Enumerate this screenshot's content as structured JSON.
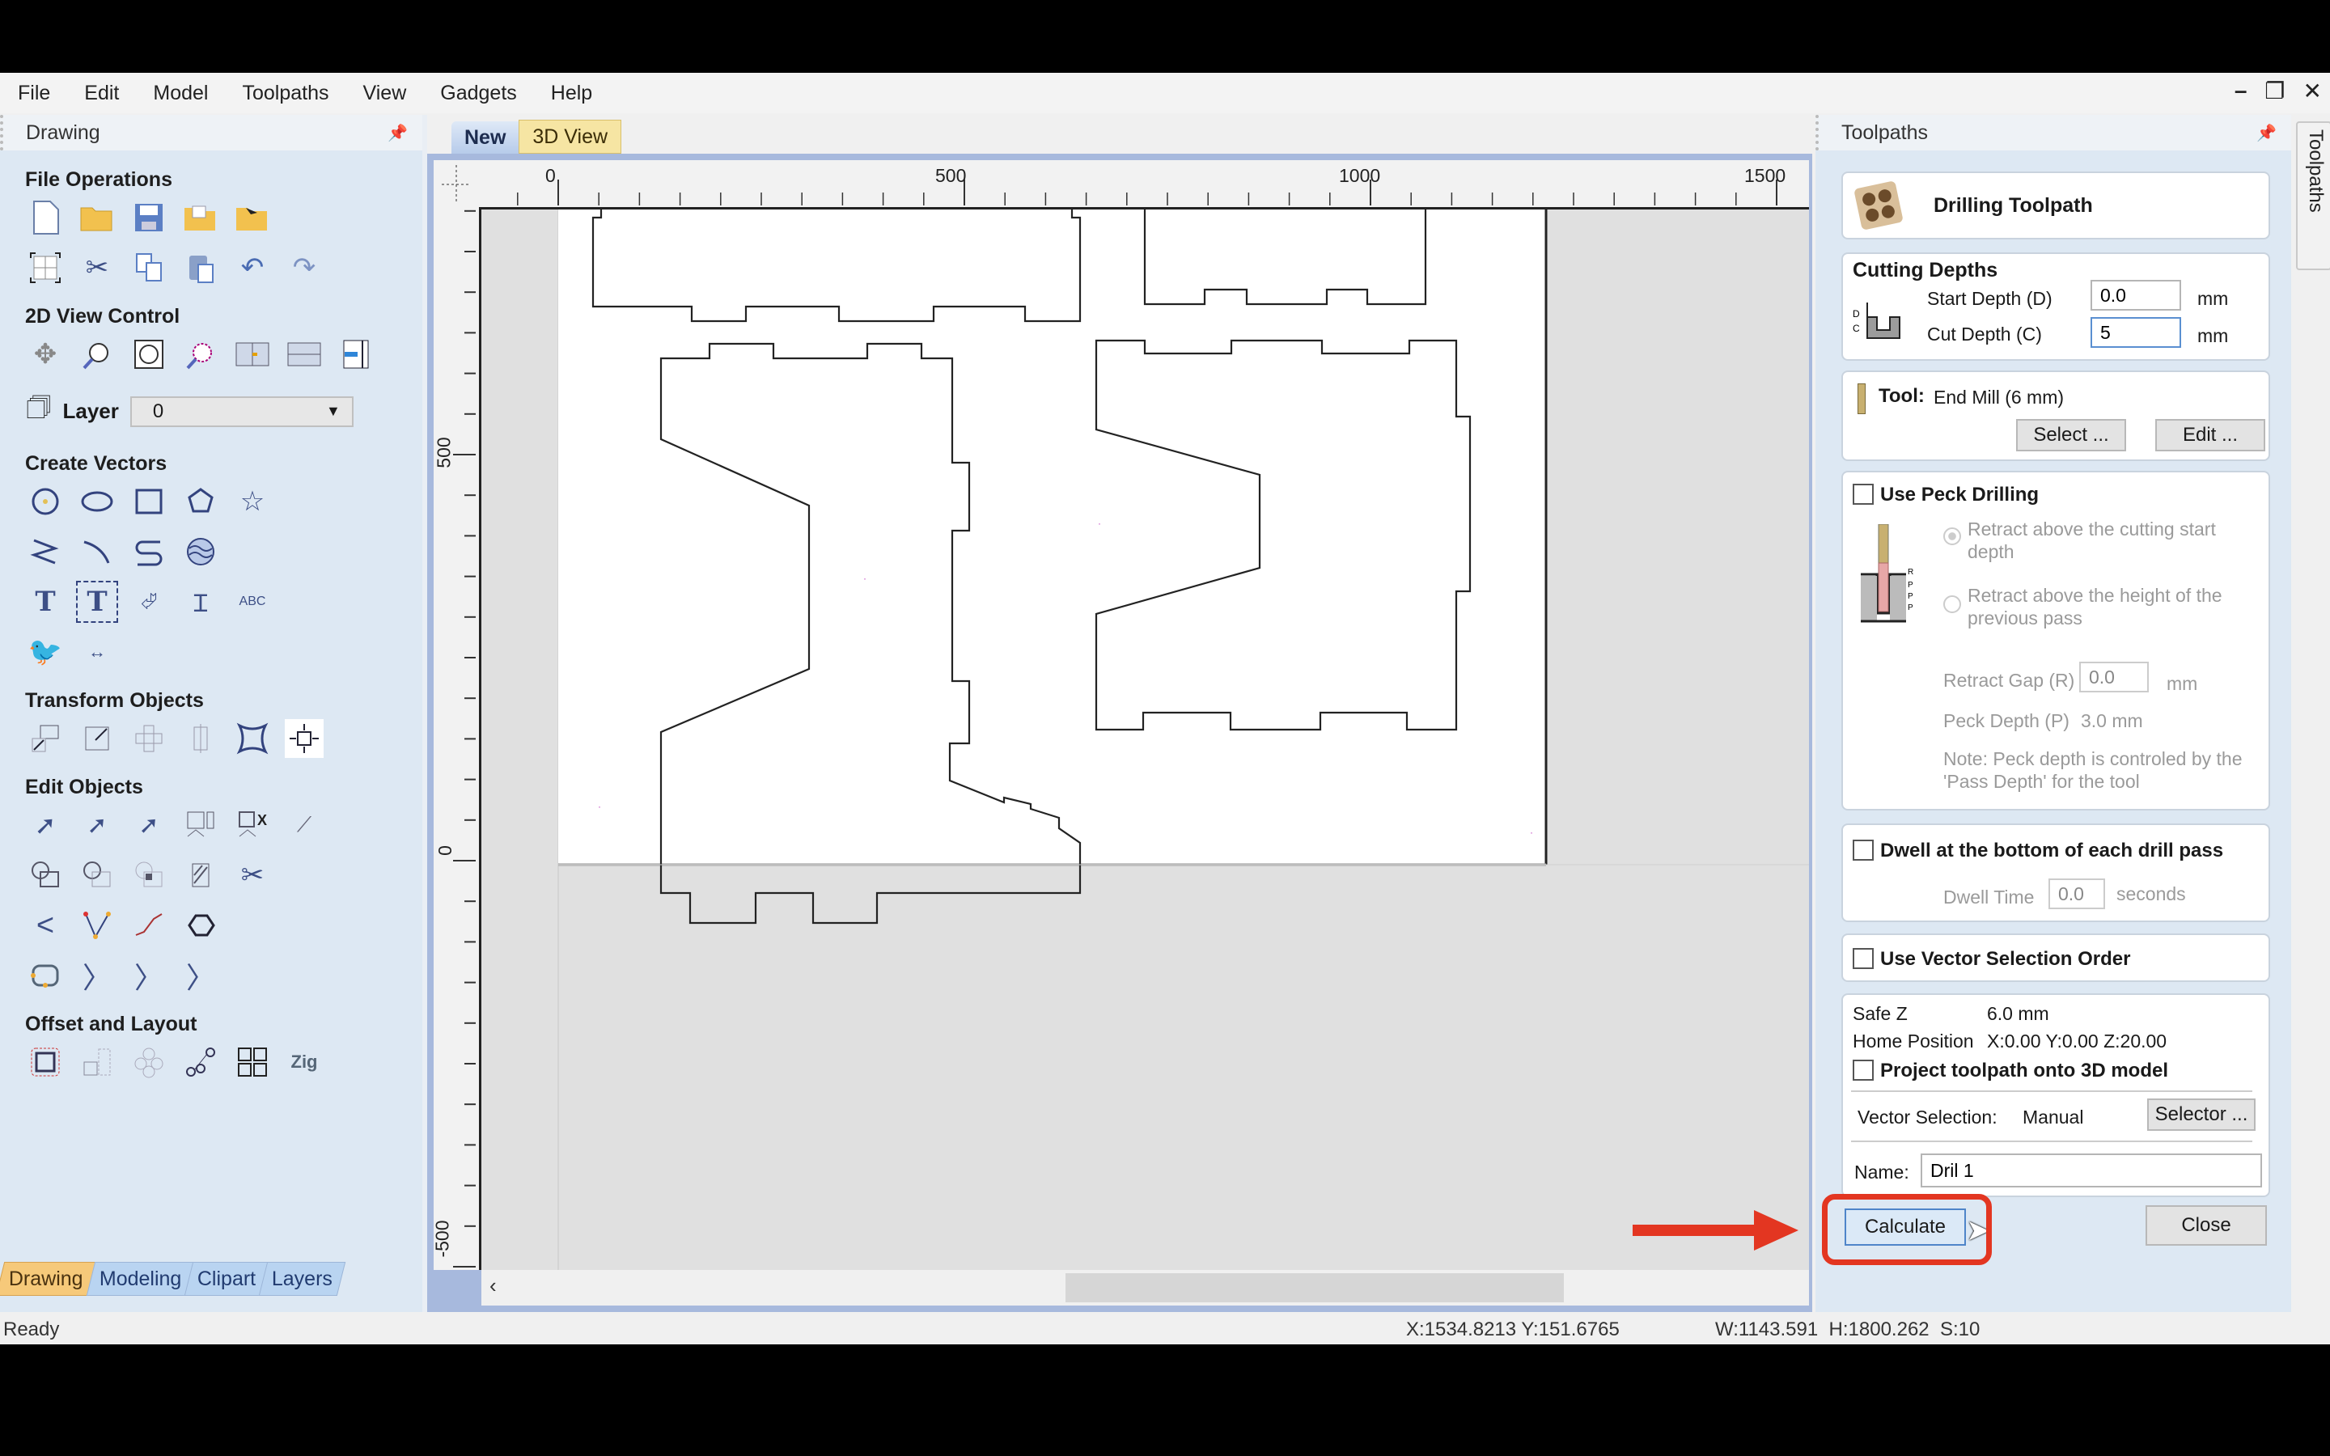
{
  "menu": [
    "File",
    "Edit",
    "Model",
    "Toolpaths",
    "View",
    "Gadgets",
    "Help"
  ],
  "window_controls": {
    "minimize": "–",
    "restore": "❐",
    "close": "✕"
  },
  "left_panel": {
    "title": "Drawing",
    "sections": {
      "file_ops": "File Operations",
      "view_control": "2D View Control",
      "create_vectors": "Create Vectors",
      "transform": "Transform Objects",
      "edit": "Edit Objects",
      "offset": "Offset and Layout"
    },
    "layer_label": "Layer",
    "layer_value": "0",
    "bottom_tabs": [
      "Drawing",
      "Modeling",
      "Clipart",
      "Layers"
    ],
    "active_tab": "Drawing"
  },
  "document": {
    "tabs": [
      "New",
      "3D View"
    ],
    "active_tab": "New",
    "h_ruler_labels": [
      "0",
      "500",
      "1000",
      "1500"
    ],
    "v_ruler_labels": [
      "500",
      "0",
      "-500"
    ]
  },
  "toolpaths": {
    "panel_title": "Toolpaths",
    "side_tab": "Toolpaths",
    "header": "Drilling Toolpath",
    "cutting_depths": {
      "title": "Cutting Depths",
      "start_label": "Start Depth (D)",
      "start_value": "0.0",
      "cut_label": "Cut Depth (C)",
      "cut_value": "5",
      "unit": "mm"
    },
    "tool": {
      "label": "Tool:",
      "value": "End Mill (6 mm)",
      "select_btn": "Select ...",
      "edit_btn": "Edit ..."
    },
    "peck": {
      "label": "Use Peck Drilling",
      "checked": false,
      "radio1": "Retract above the cutting start depth",
      "radio2": "Retract above the height of the previous pass",
      "retract_gap_label": "Retract Gap (R)",
      "retract_gap_value": "0.0",
      "retract_gap_unit": "mm",
      "peck_depth_label": "Peck Depth (P)",
      "peck_depth_value": "3.0 mm",
      "note": "Note: Peck depth is controled by the 'Pass Depth' for the tool"
    },
    "dwell": {
      "label": "Dwell at the bottom of each drill pass",
      "checked": false,
      "time_label": "Dwell Time",
      "time_value": "0.0",
      "time_unit": "seconds"
    },
    "vector_order": {
      "label": "Use Vector Selection Order",
      "checked": false
    },
    "info": {
      "safe_z_label": "Safe Z",
      "safe_z_value": "6.0 mm",
      "home_label": "Home Position",
      "home_value": "X:0.00 Y:0.00 Z:20.00",
      "project_label": "Project toolpath onto 3D model",
      "project_checked": false,
      "vec_sel_label": "Vector Selection:",
      "vec_sel_value": "Manual",
      "selector_btn": "Selector ...",
      "name_label": "Name:",
      "name_value": "Dril 1"
    },
    "calculate_btn": "Calculate",
    "close_btn": "Close"
  },
  "status": {
    "left": "Ready",
    "coords": "X:1534.8213 Y:151.6765",
    "dims": "W:1143.591  H:1800.262  S:10"
  },
  "annotation": {
    "color": "#e33621",
    "target": "Calculate"
  }
}
